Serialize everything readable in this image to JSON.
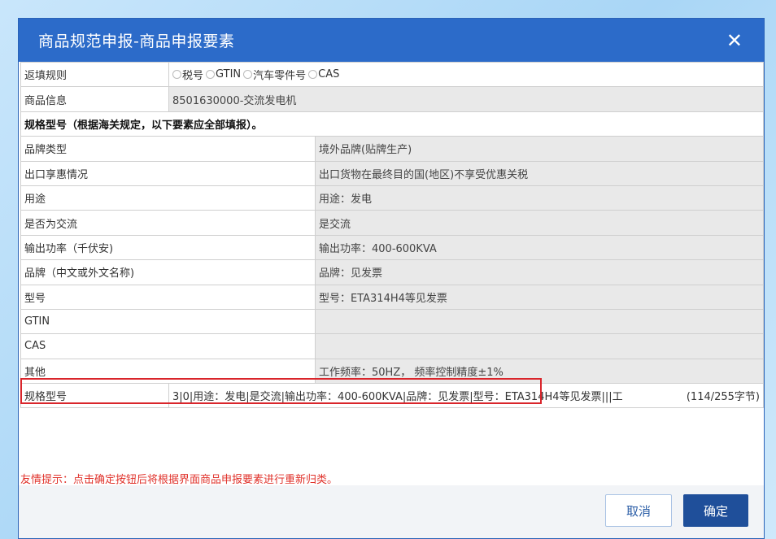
{
  "dialog": {
    "title": "商品规范申报-商品申报要素",
    "close_glyph": "✕"
  },
  "fill_rule": {
    "label": "返填规则",
    "options": [
      "税号",
      "GTIN",
      "汽车零件号",
      "CAS"
    ]
  },
  "product_info": {
    "label": "商品信息",
    "value": "8501630000-交流发电机"
  },
  "section_header": "规格型号（根据海关规定，以下要素应全部填报）。",
  "elements": [
    {
      "label": "品牌类型",
      "value": "境外品牌(贴牌生产)"
    },
    {
      "label": "出口享惠情况",
      "value": "出口货物在最终目的国(地区)不享受优惠关税"
    },
    {
      "label": "用途",
      "value": "用途：发电"
    },
    {
      "label": "是否为交流",
      "value": "是交流"
    },
    {
      "label": "输出功率（千伏安)",
      "value": "输出功率：400-600KVA"
    },
    {
      "label": "品牌（中文或外文名称)",
      "value": "品牌：见发票"
    },
    {
      "label": "型号",
      "value": "型号：ETA314H4等见发票"
    },
    {
      "label": "GTIN",
      "value": ""
    },
    {
      "label": "CAS",
      "value": ""
    },
    {
      "label": "其他",
      "value": "工作频率：50HZ， 频率控制精度±1%"
    }
  ],
  "spec_model": {
    "label": "规格型号",
    "value": "3|0|用途：发电|是交流|输出功率：400-600KVA|品牌：见发票|型号：ETA314H4等见发票|||工",
    "count": "(114/255字节)"
  },
  "tip": "友情提示：点击确定按钮后将根据界面商品申报要素进行重新归类。",
  "buttons": {
    "cancel": "取消",
    "ok": "确定"
  },
  "colors": {
    "title_bar": "#2c6bc9",
    "highlight_border": "#d9252b",
    "tip_text": "#e0322b",
    "ok_button": "#1f4f9a"
  }
}
